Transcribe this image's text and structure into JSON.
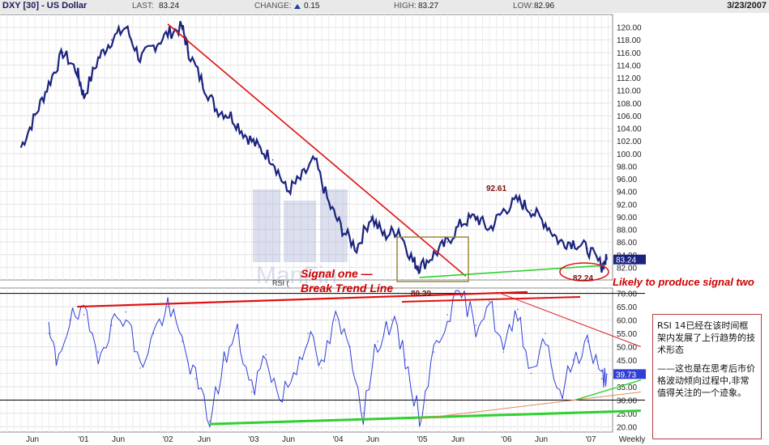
{
  "header": {
    "title": "DXY [30] - US Dollar",
    "last_label": "LAST:",
    "last_value": "83.24",
    "change_label": "CHANGE:",
    "change_value": "0.15",
    "high_label": "HIGH:",
    "high_value": "83.27",
    "low_label": "LOW:",
    "low_value": "82.96",
    "date": "3/23/2007"
  },
  "price_labels": {
    "last_tag": "83.24"
  },
  "rsi_panel": {
    "label": "RSI (",
    "last_tag": "39.73"
  },
  "annotations": {
    "signal_one_line1": "Signal one —",
    "signal_one_line2": "Break Trend Line",
    "signal_two": "Likely to produce signal two",
    "low_80": "80.39",
    "high_92": "92.61",
    "low_82": "82.24",
    "watermark": "ManFin"
  },
  "cn_notes": {
    "p1": "RSI 14已经在该时间框架内发展了上行趋势的技术形态",
    "p2": "——这也是在思考后市价格波动倾向过程中,非常值得关注的一个迹象。"
  },
  "colors": {
    "price": "#1a237e",
    "rsi": "#2f3fd6",
    "trend": "#e01010",
    "support": "#30d030",
    "note": "#c01010"
  },
  "chart_data": [
    {
      "type": "line",
      "title": "DXY [30] - US Dollar",
      "xlabel": "Weekly",
      "ylim": [
        80,
        122
      ],
      "y_ticks": [
        "82.00",
        "84.00",
        "86.00",
        "88.00",
        "90.00",
        "92.00",
        "94.00",
        "96.00",
        "98.00",
        "100.00",
        "102.00",
        "104.00",
        "106.00",
        "108.00",
        "110.00",
        "112.00",
        "114.00",
        "116.00",
        "118.00",
        "120.00"
      ],
      "x_ticks": [
        "Jun",
        "'01",
        "Jun",
        "'02",
        "Jun",
        "'03",
        "Jun",
        "'04",
        "Jun",
        "'05",
        "Jun",
        "'06",
        "Jun",
        "'07",
        "Weekly"
      ],
      "series": [
        {
          "x": [
            2000.25,
            2000.42,
            2000.58,
            2000.75,
            2000.92,
            2001.0,
            2001.17,
            2001.33,
            2001.5,
            2001.67,
            2001.83,
            2002.0,
            2002.17,
            2002.25,
            2002.42,
            2002.58,
            2002.75,
            2002.92,
            2003.08,
            2003.25,
            2003.42,
            2003.58,
            2003.75,
            2003.92,
            2004.08,
            2004.25,
            2004.42,
            2004.58,
            2004.75,
            2004.92,
            2005.0,
            2005.17,
            2005.33,
            2005.5,
            2005.67,
            2005.83,
            2006.0,
            2006.17,
            2006.33,
            2006.5,
            2006.67,
            2006.83,
            2007.0,
            2007.17,
            2007.23
          ],
          "values": [
            101,
            106,
            111,
            116,
            113,
            109,
            115,
            118,
            120,
            115,
            117,
            119,
            120,
            116,
            111,
            107,
            106,
            103,
            101,
            99,
            94,
            96,
            99,
            92,
            88,
            85,
            90,
            87,
            88,
            83,
            82,
            84,
            86,
            89,
            90,
            88,
            91,
            92.61,
            91,
            89,
            86,
            86,
            85,
            82.24,
            83.24
          ]
        }
      ],
      "trendlines": [
        {
          "name": "Break Trend Line",
          "points": [
            [
              2002.0,
              120.5
            ],
            [
              2005.55,
              80.6
            ]
          ]
        },
        {
          "name": "support",
          "points": [
            [
              2005.0,
              80.39
            ],
            [
              2007.2,
              82.3
            ]
          ]
        }
      ],
      "annotations": [
        "80.39",
        "92.61",
        "82.24",
        "Signal one — Break Trend Line",
        "Likely to produce signal two"
      ]
    },
    {
      "type": "line",
      "title": "RSI",
      "ylim": [
        18,
        72
      ],
      "y_ticks": [
        "20.00",
        "25.00",
        "30.00",
        "35.00",
        "40.00",
        "45.00",
        "50.00",
        "55.00",
        "60.00",
        "65.00",
        "70.00"
      ],
      "reference_lines": [
        30,
        70
      ],
      "series": [
        {
          "x": [
            2000.58,
            2000.67,
            2000.83,
            2001.0,
            2001.17,
            2001.33,
            2001.5,
            2001.67,
            2001.83,
            2002.0,
            2002.17,
            2002.33,
            2002.5,
            2002.67,
            2002.83,
            2003.0,
            2003.17,
            2003.33,
            2003.5,
            2003.67,
            2003.83,
            2004.0,
            2004.17,
            2004.33,
            2004.5,
            2004.67,
            2004.83,
            2005.0,
            2005.17,
            2005.33,
            2005.5,
            2005.67,
            2005.83,
            2006.0,
            2006.17,
            2006.33,
            2006.5,
            2006.67,
            2006.83,
            2007.0,
            2007.17,
            2007.23
          ],
          "values": [
            55,
            45,
            60,
            62,
            48,
            58,
            63,
            42,
            55,
            65,
            52,
            38,
            22,
            45,
            55,
            33,
            47,
            30,
            40,
            55,
            42,
            60,
            50,
            25,
            52,
            60,
            45,
            23,
            48,
            62,
            70,
            58,
            67,
            48,
            64,
            40,
            55,
            30,
            45,
            52,
            38,
            39.73
          ]
        }
      ],
      "trendlines": [
        {
          "name": "resistance",
          "points": [
            [
              2000.92,
              65
            ],
            [
              2005.9,
              70.5
            ]
          ]
        },
        {
          "name": "rsi-downtrend",
          "points": [
            [
              2005.92,
              70.5
            ],
            [
              2007.25,
              50
            ]
          ]
        },
        {
          "name": "support",
          "points": [
            [
              2002.5,
              21
            ],
            [
              2007.25,
              26
            ]
          ]
        },
        {
          "name": "support-2",
          "points": [
            [
              2006.85,
              30
            ],
            [
              2007.25,
              37.5
            ]
          ]
        },
        {
          "name": "support-3",
          "points": [
            [
              2005.0,
              23
            ],
            [
              2007.25,
              33
            ]
          ]
        }
      ]
    }
  ]
}
